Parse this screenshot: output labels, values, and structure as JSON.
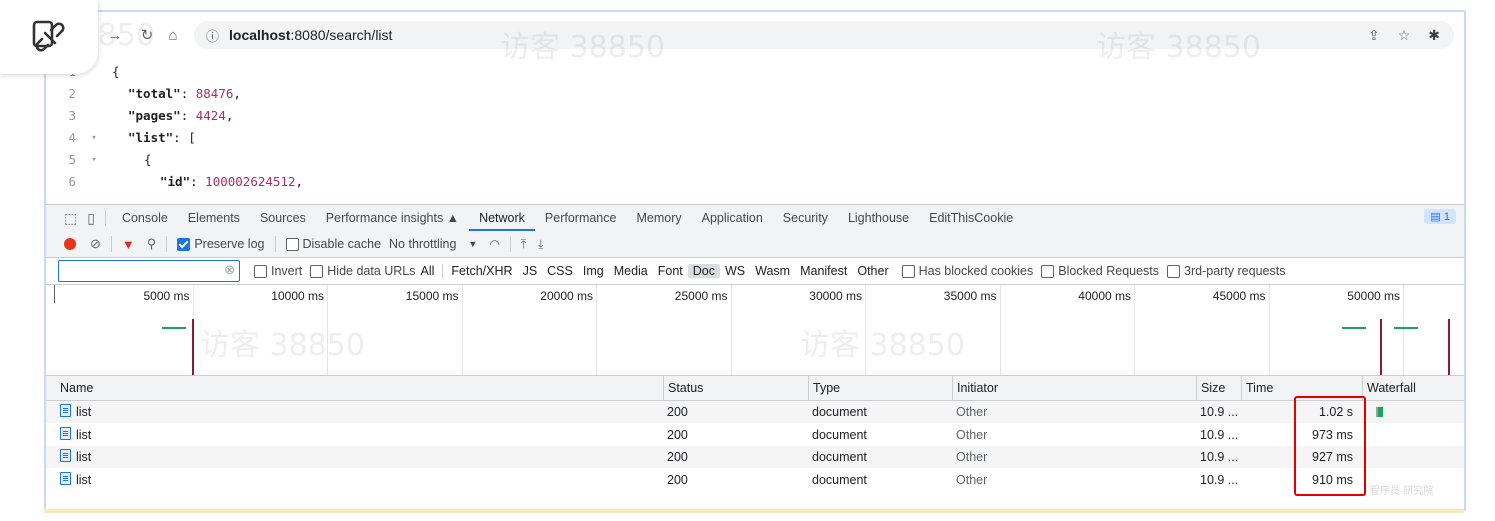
{
  "browser": {
    "url_host": "localhost",
    "url_rest": ":8080/search/list"
  },
  "json_view": {
    "lines": [
      {
        "n": "1",
        "fold": "",
        "indent": 0,
        "key": "",
        "value": "",
        "text": "{"
      },
      {
        "n": "2",
        "fold": "",
        "indent": 1,
        "key": "\"total\"",
        "value": "88476",
        "text": ","
      },
      {
        "n": "3",
        "fold": "",
        "indent": 1,
        "key": "\"pages\"",
        "value": "4424",
        "text": ","
      },
      {
        "n": "4",
        "fold": "▾",
        "indent": 1,
        "key": "\"list\"",
        "value": "",
        "text": "["
      },
      {
        "n": "5",
        "fold": "▾",
        "indent": 2,
        "key": "",
        "value": "",
        "text": "{"
      },
      {
        "n": "6",
        "fold": "",
        "indent": 3,
        "key": "\"id\"",
        "value": "100002624512",
        "text": ","
      }
    ]
  },
  "devtools": {
    "tabs": [
      "Console",
      "Elements",
      "Sources",
      "Performance insights ▲",
      "Network",
      "Performance",
      "Memory",
      "Application",
      "Security",
      "Lighthouse",
      "EditThisCookie"
    ],
    "active_tab": "Network",
    "issues_badge": "1",
    "toolbar": {
      "preserve_log": "Preserve log",
      "disable_cache": "Disable cache",
      "throttling": "No throttling"
    },
    "filter": {
      "invert": "Invert",
      "hide_data_urls": "Hide data URLs",
      "types": [
        "All",
        "Fetch/XHR",
        "JS",
        "CSS",
        "Img",
        "Media",
        "Font",
        "Doc",
        "WS",
        "Wasm",
        "Manifest",
        "Other"
      ],
      "selected_type": "Doc",
      "has_blocked_cookies": "Has blocked cookies",
      "blocked_requests": "Blocked Requests",
      "third_party": "3rd-party requests"
    },
    "overview_ticks": [
      "5000 ms",
      "10000 ms",
      "15000 ms",
      "20000 ms",
      "25000 ms",
      "30000 ms",
      "35000 ms",
      "40000 ms",
      "45000 ms",
      "50000 ms"
    ],
    "columns": [
      "Name",
      "Status",
      "Type",
      "Initiator",
      "Size",
      "Time",
      "Waterfall"
    ],
    "rows": [
      {
        "name": "list",
        "status": "200",
        "type": "document",
        "initiator": "Other",
        "size": "10.9 ...",
        "time": "1.02 s"
      },
      {
        "name": "list",
        "status": "200",
        "type": "document",
        "initiator": "Other",
        "size": "10.9 ...",
        "time": "973 ms"
      },
      {
        "name": "list",
        "status": "200",
        "type": "document",
        "initiator": "Other",
        "size": "10.9 ...",
        "time": "927 ms"
      },
      {
        "name": "list",
        "status": "200",
        "type": "document",
        "initiator": "Other",
        "size": "10.9 ...",
        "time": "910 ms"
      }
    ]
  },
  "watermarks": [
    "访客 38850",
    "访客 38850",
    "访客 38850",
    "访客 38850",
    "访客 38850",
    "程序员·研究院"
  ],
  "colors": {
    "accent": "#1a73e8",
    "highlight": "#e30000",
    "json_number": "#a0306e"
  }
}
